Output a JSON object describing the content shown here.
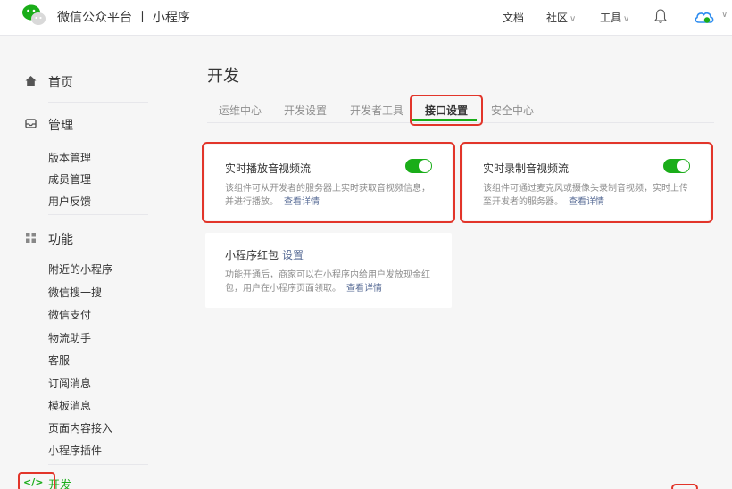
{
  "header": {
    "brand": "微信公众平台 丨 小程序",
    "nav": {
      "docs": "文档",
      "community": "社区",
      "tools": "工具"
    },
    "caret": "∨"
  },
  "sidebar": {
    "home": "首页",
    "manage": "管理",
    "manage_items": [
      "版本管理",
      "成员管理",
      "用户反馈"
    ],
    "features": "功能",
    "feature_items": [
      "附近的小程序",
      "微信搜一搜",
      "微信支付",
      "物流助手",
      "客服",
      "订阅消息",
      "模板消息",
      "页面内容接入",
      "小程序插件"
    ],
    "develop": "开发",
    "develop_icon": "</>"
  },
  "main": {
    "title": "开发",
    "tabs": [
      "运维中心",
      "开发设置",
      "开发者工具",
      "接口设置",
      "安全中心"
    ],
    "active_tab": "接口设置",
    "cards": [
      {
        "title": "实时播放音视频流",
        "desc_line1": "该组件可从开发者的服务器上实时获取音视频信息，",
        "desc_line2": "并进行播放。",
        "link": "查看详情",
        "toggle": "on"
      },
      {
        "title": "实时录制音视频流",
        "desc_line1": "该组件可通过麦克风或摄像头录制音视频，实时上传",
        "desc_line2": "至开发者的服务器。",
        "link": "查看详情",
        "toggle": "on"
      },
      {
        "title": "小程序红包",
        "title_link": "设置",
        "desc_line1": "功能开通后，商家可以在小程序内给用户发放现金红",
        "desc_line2": "包，用户在小程序页面领取。",
        "link": "查看详情"
      }
    ]
  },
  "colors": {
    "accent_green": "#1aad19",
    "highlight_red": "#e2352a",
    "link_blue": "#576b95"
  }
}
